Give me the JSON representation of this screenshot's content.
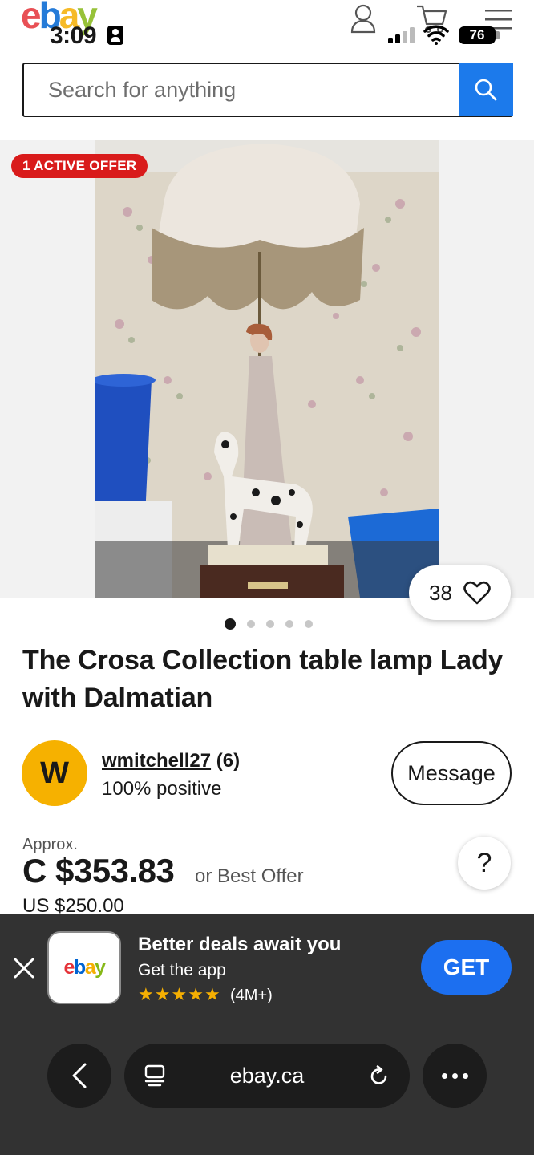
{
  "status_bar": {
    "time": "3:09",
    "battery": "76"
  },
  "header": {
    "logo": {
      "e": "e",
      "b": "b",
      "a": "a",
      "y": "y"
    },
    "icons": [
      "user-icon",
      "cart-icon",
      "menu-icon"
    ]
  },
  "search": {
    "placeholder": "Search for anything",
    "button_icon": "search-icon"
  },
  "gallery": {
    "offer_badge": "1 ACTIVE OFFER",
    "watch_count": "38",
    "image_count": 5,
    "active_index": 0
  },
  "listing": {
    "title": "The Crosa Collection table lamp Lady with Dalmatian"
  },
  "seller": {
    "initial": "W",
    "username": "wmitchell27",
    "feedback_count": "(6)",
    "feedback_percent": "100% positive",
    "message_label": "Message"
  },
  "price": {
    "approx_label": "Approx.",
    "amount": "C $353.83",
    "best_offer": "or Best Offer",
    "usd": "US $250.00",
    "help": "?"
  },
  "app_banner": {
    "title": "Better deals await you",
    "subtitle": "Get the app",
    "rating_count": "(4M+)",
    "star_count": 5,
    "get_label": "GET",
    "logo": {
      "e": "e",
      "b": "b",
      "a": "a",
      "y": "y"
    }
  },
  "browser": {
    "url": "ebay.ca"
  },
  "colors": {
    "brand_blue": "#1c7aeb",
    "badge_red": "#d91b1b",
    "avatar_yellow": "#f6b100",
    "banner_bg": "#323232",
    "get_blue": "#1c6ff0"
  }
}
